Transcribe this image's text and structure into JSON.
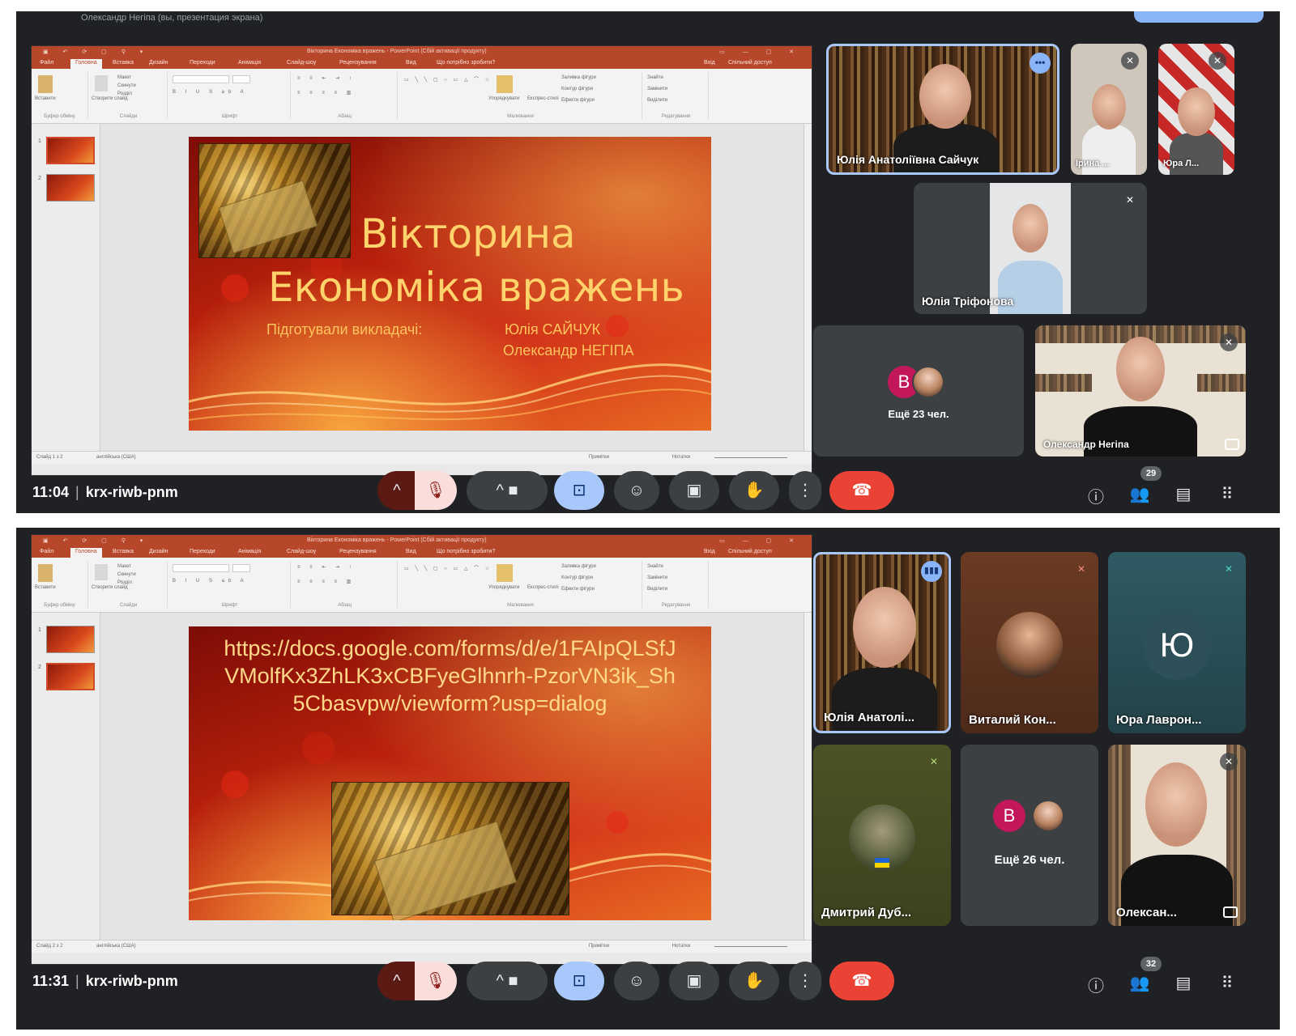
{
  "app": {
    "name": "Google Meet",
    "top_title": "Олександр Негіпа (вы, презентация экрана)",
    "meeting_code": "krx-riwb-pnm"
  },
  "powerpoint": {
    "doc_title": "Вікторина Економіка вражень - PowerPoint (Сбій активації продукту)",
    "tabs": [
      "Файл",
      "Головна",
      "Вставка",
      "Дизайн",
      "Переходи",
      "Анімація",
      "Слайд-шоу",
      "Рецензування",
      "Вид",
      "Що потрібно зробити?"
    ],
    "right_tabs": [
      "Вхід",
      "Спільний доступ"
    ],
    "ribbon_groups": [
      "Буфер обміну",
      "Слайди",
      "Шрифт",
      "Абзац",
      "Малювання",
      "Редагування"
    ],
    "ribbon_buttons": [
      "Вставити",
      "Створити слайд",
      "Макет",
      "Скинути",
      "Розділ",
      "Упорядкувати",
      "Експрес-стилі",
      "Заливка фігури",
      "Контур фігури",
      "Ефекти фігури",
      "Знайти",
      "Замінити",
      "Виділити"
    ],
    "status_left": "Слайд 1 з 2",
    "status_lang": "англійська (США)",
    "status_notes": "Нотатки",
    "status_comments": "Примітки"
  },
  "screens": [
    {
      "time": "11:04",
      "slide": {
        "title_line1": "Вікторина",
        "title_line2": "Економіка вражень",
        "prepared_by": "Підготували викладачі:",
        "author1": "Юлія САЙЧУК",
        "author2": "Олександр НЕГІПА"
      },
      "status_slide": "Слайд 1 з 2",
      "tiles": [
        "Юлія Анатоліївна Сайчук",
        "Ірина ...",
        "Юра Л...",
        "Юлія Тріфонова",
        "Олександр Негіпа"
      ],
      "more_label": "Ещё 23 чел.",
      "avatar_letter": "B",
      "participants_count": "29"
    },
    {
      "time": "11:31",
      "slide": {
        "url": "https://docs.google.com/forms/d/e/1FAIpQLSfJVMolfKx3ZhLK3xCBFyeGlhnrh-PzorVN3ik_Sh5Cbasvpw/viewform?usp=dialog"
      },
      "status_slide": "Слайд 2 з 2",
      "tiles": [
        "Юлія Анатолі...",
        "Виталий Кон...",
        "Юра Лаврон...",
        "Дмитрий Дуб...",
        "Олексан..."
      ],
      "tile_letter": "Ю",
      "more_label": "Ещё 26 чел.",
      "avatar_letter": "B",
      "participants_count": "32"
    }
  ],
  "controls": {
    "icons": [
      "chevron-up",
      "mic-off",
      "chevron-up",
      "camera",
      "present",
      "emoji",
      "captions",
      "raise-hand",
      "more-vert",
      "end-call"
    ],
    "right_icons": [
      "info",
      "people",
      "chat",
      "activities"
    ]
  },
  "colors": {
    "meet_bg": "#202124",
    "tile_bg": "#3c4043",
    "ppt_accent": "#b7472a",
    "slide_text": "#ffd36b",
    "active_blue": "#a8c7fa",
    "end_call": "#ea4335",
    "avatar_pink": "#c2185b"
  }
}
